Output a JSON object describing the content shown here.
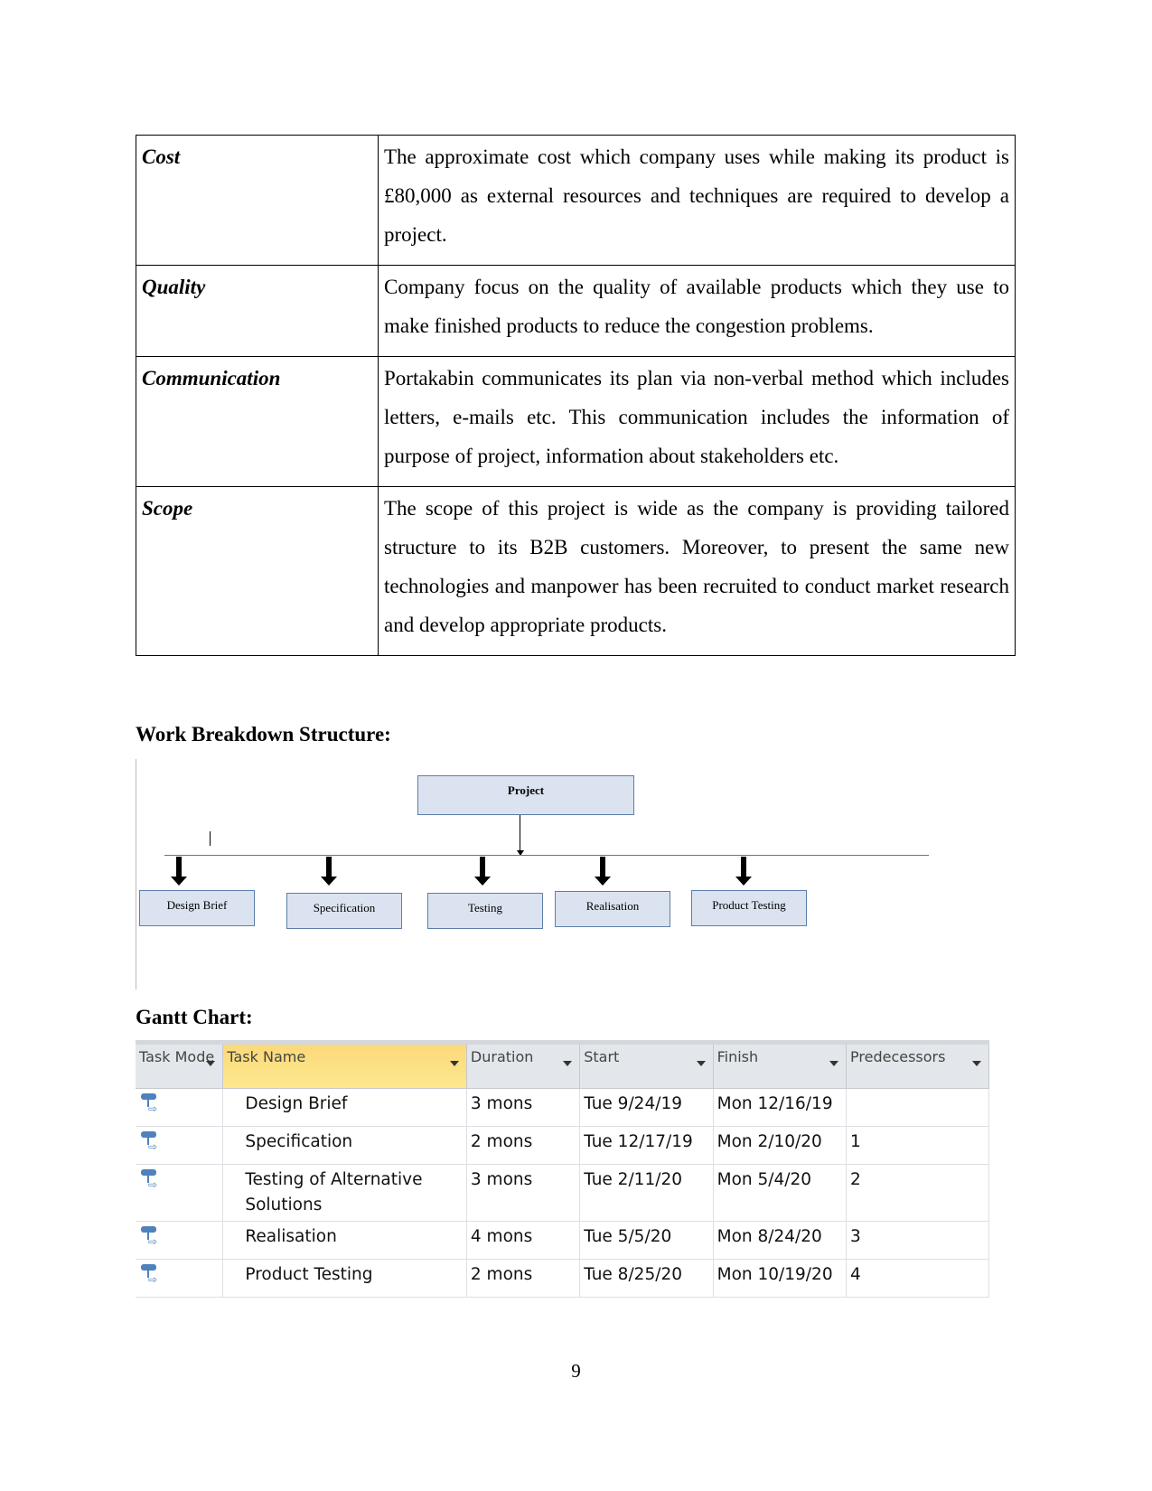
{
  "requirements": [
    {
      "label": "Cost",
      "text": "The approximate cost which company uses while making its product is £80,000 as external resources and techniques are required to develop a project."
    },
    {
      "label": "Quality",
      "text": "Company focus on the quality of available products which they use to make finished products to reduce the congestion problems."
    },
    {
      "label": "Communication",
      "text": "Portakabin communicates its plan via non-verbal method which includes letters, e-mails etc. This communication includes the information of purpose of project, information about stakeholders etc."
    },
    {
      "label": "Scope",
      "text": "The scope of this project is wide as the company is providing tailored structure to its B2B customers. Moreover, to present the same new technologies and manpower has been recruited to conduct market research and develop appropriate products."
    }
  ],
  "wbs": {
    "heading": "Work Breakdown Structure:",
    "root": "Project",
    "children": [
      "Design Brief",
      "Specification",
      "Testing",
      "Realisation",
      "Product Testing"
    ]
  },
  "gantt": {
    "heading": "Gantt Chart:",
    "columns": [
      "Task Mode",
      "Task Name",
      "Duration",
      "Start",
      "Finish",
      "Predecessors"
    ],
    "mode_icon": "auto-scheduled-task-icon",
    "rows": [
      {
        "name": "Design Brief",
        "duration": "3 mons",
        "start": "Tue 9/24/19",
        "finish": "Mon 12/16/19",
        "predecessors": ""
      },
      {
        "name": "Specification",
        "duration": "2 mons",
        "start": "Tue 12/17/19",
        "finish": "Mon 2/10/20",
        "predecessors": "1"
      },
      {
        "name": "Testing of Alternative Solutions",
        "duration": "3 mons",
        "start": "Tue 2/11/20",
        "finish": "Mon 5/4/20",
        "predecessors": "2"
      },
      {
        "name": "Realisation",
        "duration": "4 mons",
        "start": "Tue 5/5/20",
        "finish": "Mon 8/24/20",
        "predecessors": "3"
      },
      {
        "name": "Product Testing",
        "duration": "2 mons",
        "start": "Tue 8/25/20",
        "finish": "Mon 10/19/20",
        "predecessors": "4"
      }
    ]
  },
  "page_number": "9"
}
